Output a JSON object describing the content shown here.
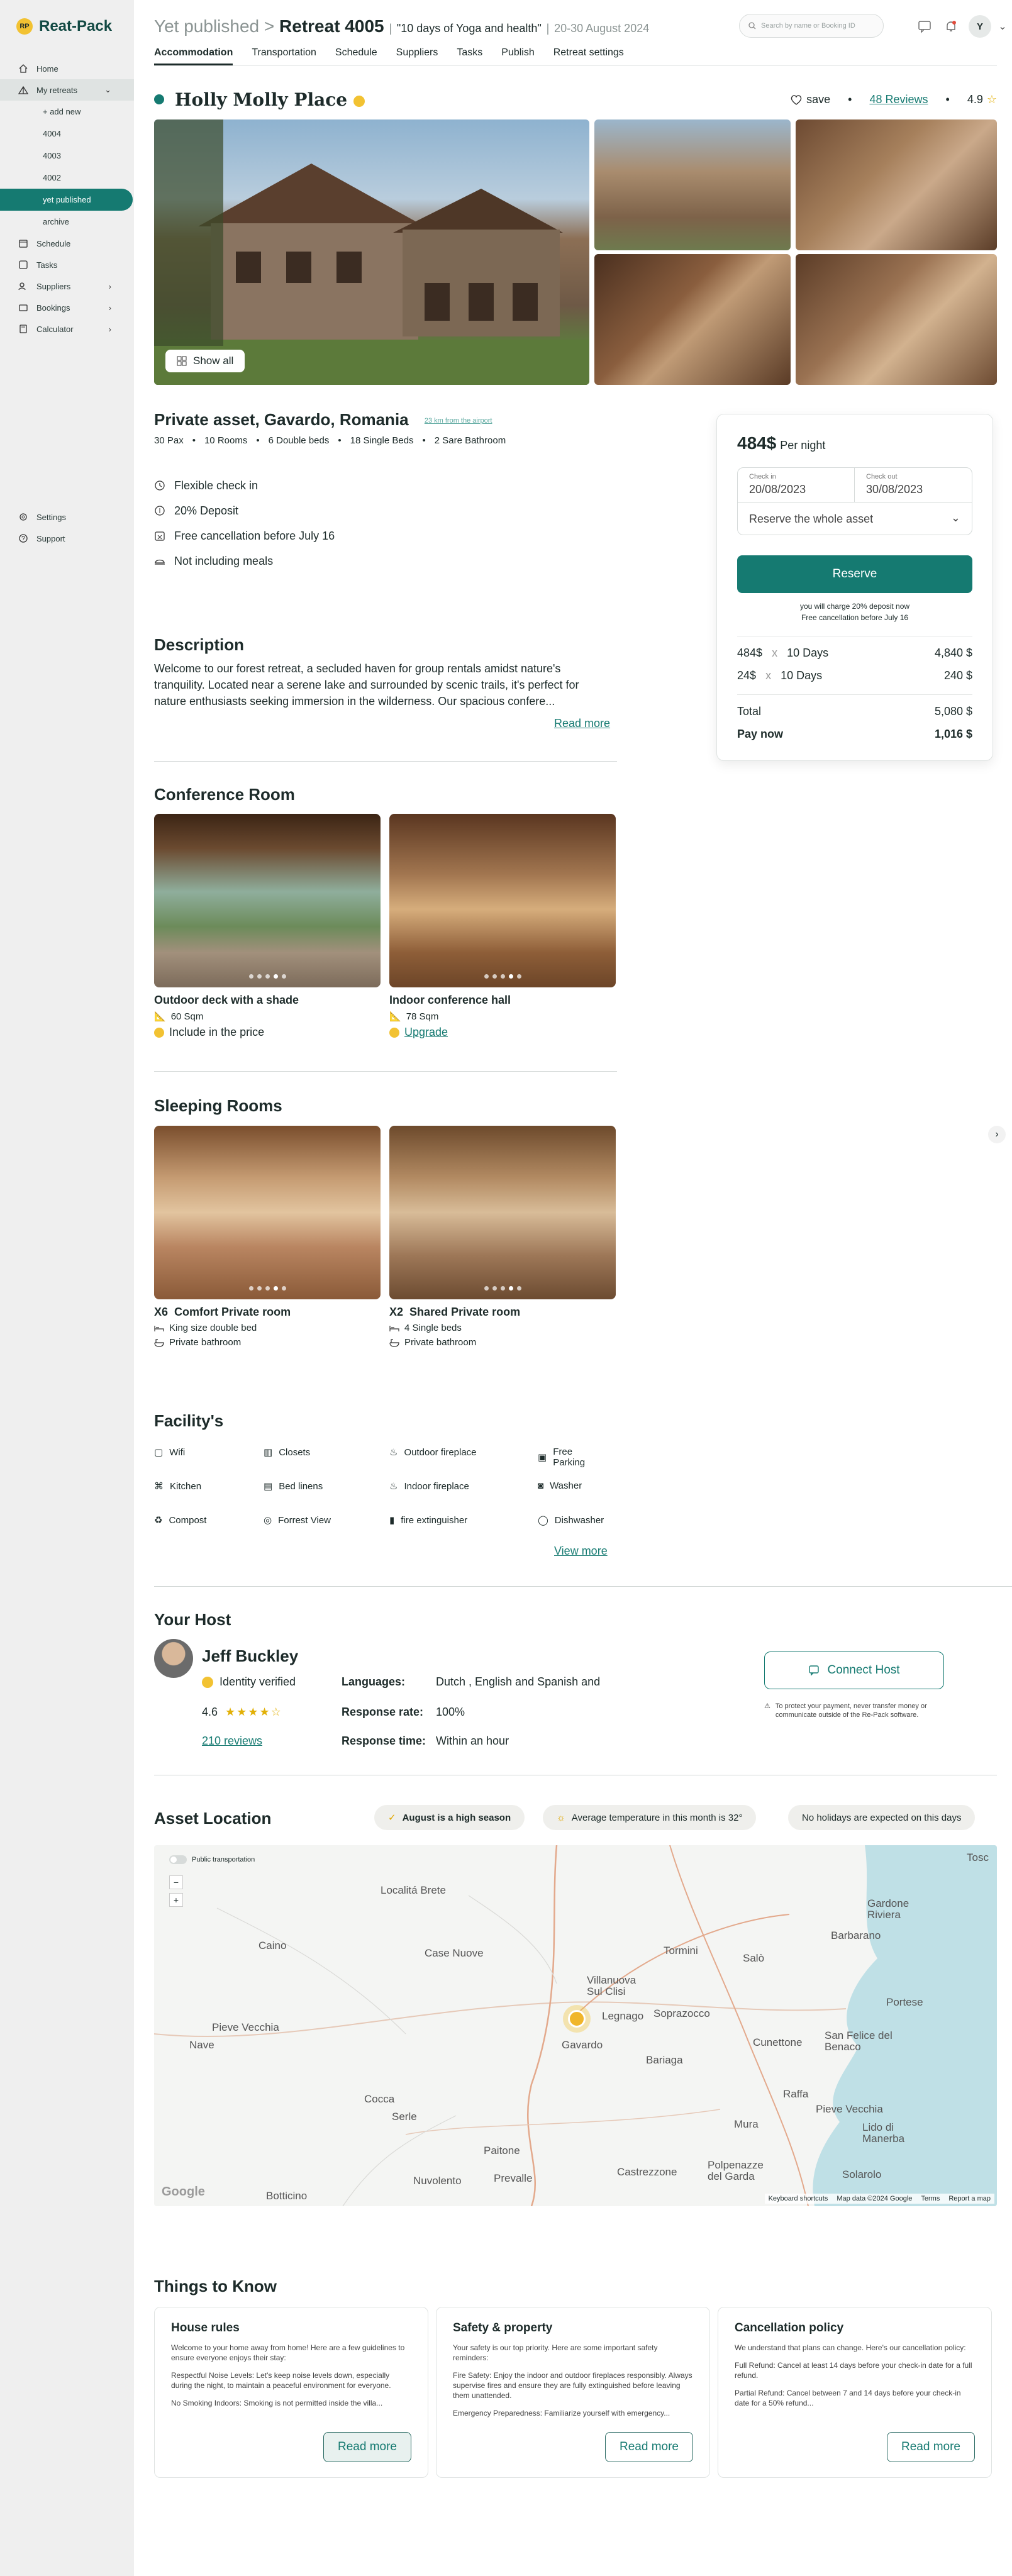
{
  "app": {
    "name": "Reat-Pack",
    "logo_text": "RP"
  },
  "sidebar": {
    "items": [
      {
        "label": "Home",
        "icon": "home-icon"
      },
      {
        "label": "My retreats",
        "icon": "tent-icon"
      },
      {
        "label": "Schedule",
        "icon": "calendar-icon"
      },
      {
        "label": "Tasks",
        "icon": "tasks-icon"
      },
      {
        "label": "Suppliers",
        "icon": "suppliers-icon"
      },
      {
        "label": "Bookings",
        "icon": "bookings-icon"
      },
      {
        "label": "Calculator",
        "icon": "calculator-icon"
      }
    ],
    "subitems": [
      "+ add new",
      "4004",
      "4003",
      "4002",
      "yet published",
      "archive"
    ],
    "bottom": [
      {
        "label": "Settings",
        "icon": "gear-icon"
      },
      {
        "label": "Support",
        "icon": "support-icon"
      }
    ]
  },
  "header": {
    "status": "Yet published",
    "retreat": "Retreat 4005",
    "retreat_name": "\"10 days of Yoga and health\"",
    "dates": "20-30 August 2024",
    "search_placeholder": "Search by name or Booking ID",
    "avatar": "Y"
  },
  "tabs": [
    "Accommodation",
    "Transportation",
    "Schedule",
    "Suppliers",
    "Tasks",
    "Publish",
    "Retreat settings"
  ],
  "listing": {
    "title": "Holly Molly Place",
    "save": "save",
    "reviews": "48 Reviews",
    "rating": "4.9",
    "show_all": "Show all",
    "asset_title": "Private asset, Gavardo, Romania",
    "distance": "23 km from the airport",
    "meta": [
      "30 Pax",
      "10 Rooms",
      "6 Double beds",
      "18 Single Beds",
      "2 Sare Bathroom"
    ],
    "perks": [
      {
        "label": "Flexible check in",
        "icon": "clock-icon"
      },
      {
        "label": "20% Deposit",
        "icon": "coin-icon"
      },
      {
        "label": "Free cancellation before July 16",
        "icon": "calendar-x-icon"
      },
      {
        "label": "Not including meals",
        "icon": "meal-icon"
      }
    ]
  },
  "description": {
    "heading": "Description",
    "text": "Welcome to our forest retreat, a secluded haven for group rentals amidst nature's tranquility. Located near a serene lake and surrounded by scenic trails, it's perfect for nature enthusiasts seeking immersion in the wilderness. Our spacious confere...",
    "read_more": "Read more"
  },
  "booking": {
    "price": "484$",
    "per_night": "Per night",
    "checkin_label": "Check in",
    "checkin": "20/08/2023",
    "checkout_label": "Check out",
    "checkout": "30/08/2023",
    "reserve_whole": "Reserve the whole asset",
    "reserve": "Reserve",
    "note1": "you will charge 20% deposit now",
    "note2": "Free cancellation before July 16",
    "lines": [
      {
        "a": "484$",
        "x": "x",
        "b": "10 Days",
        "total": "4,840 $"
      },
      {
        "a": "24$",
        "x": "x",
        "b": "10 Days",
        "total": "240 $"
      }
    ],
    "total_label": "Total",
    "total": "5,080 $",
    "paynow_label": "Pay now",
    "paynow": "1,016 $"
  },
  "conference": {
    "heading": "Conference Room",
    "rooms": [
      {
        "name": "Outdoor deck with a shade",
        "size": "60 Sqm",
        "extra": "Include in the price"
      },
      {
        "name": "Indoor conference hall",
        "size": "78 Sqm",
        "extra": "Upgrade"
      }
    ]
  },
  "sleeping": {
    "heading": "Sleeping Rooms",
    "rooms": [
      {
        "count": "X6",
        "name": "Comfort Private room",
        "beds": "King size double bed",
        "bath": "Private bathroom"
      },
      {
        "count": "X2",
        "name": "Shared Private room",
        "beds": "4 Single beds",
        "bath": "Private bathroom"
      }
    ]
  },
  "facilities": {
    "heading": "Facility's",
    "items": [
      [
        "Wifi",
        "Closets",
        "Outdoor fireplace",
        "Free Parking"
      ],
      [
        "Kitchen",
        "Bed linens",
        "Indoor fireplace",
        "Washer"
      ],
      [
        "Compost",
        "Forrest View",
        "fire extinguisher",
        "Dishwasher"
      ]
    ],
    "view_more": "View more"
  },
  "host": {
    "heading": "Your Host",
    "name": "Jeff Buckley",
    "verified": "Identity verified",
    "rating": "4.6",
    "reviews": "210 reviews",
    "languages_label": "Languages:",
    "languages": "Dutch , English and Spanish and",
    "response_rate_label": "Response rate:",
    "response_rate": "100%",
    "response_time_label": "Response time:",
    "response_time": "Within an hour",
    "connect": "Connect Host",
    "protect_note": "To protect your payment, never transfer money or communicate outside of the Re-Pack software."
  },
  "location": {
    "heading": "Asset Location",
    "pills": [
      "August is a high season",
      "Average temperature in this month is 32°",
      "No holidays are expected on this days"
    ],
    "transport_toggle": "Public transportation",
    "zoom_out": "−",
    "zoom_in": "+",
    "places": [
      "Localitá Brete",
      "Caino",
      "Case Nuove",
      "Tormini",
      "Salò",
      "Villanuova Sul Clisi",
      "Gardone Riviera",
      "Barbarano",
      "Tosc",
      "Pieve Vecchia",
      "Nave",
      "Legnago",
      "Soprazocco",
      "Gavardo",
      "Bariaga",
      "Portese",
      "Cunettone",
      "San Felice del Benaco",
      "Cocca",
      "Serle",
      "Raffa",
      "Pieve Vecchia",
      "Lido di Manerba",
      "Paitone",
      "Mura",
      "Nuvolento",
      "Prevalle",
      "Castrezzone",
      "Polpenazze del Garda",
      "Solarolo",
      "Botticino"
    ],
    "google": "Google",
    "footer": [
      "Keyboard shortcuts",
      "Map data ©2024 Google",
      "Terms",
      "Report a map"
    ]
  },
  "things": {
    "heading": "Things to Know",
    "cards": [
      {
        "title": "House rules",
        "p1": "Welcome to your home away from home! Here are a few guidelines to ensure everyone enjoys their stay:",
        "p2": "Respectful Noise Levels: Let's keep noise levels down, especially during the night, to maintain a peaceful environment for everyone.",
        "p3": "No Smoking Indoors: Smoking is not permitted inside the villa...",
        "btn": "Read more"
      },
      {
        "title": "Safety & property",
        "p1": "Your safety is our top priority. Here are some important safety reminders:",
        "p2": "Fire Safety: Enjoy the indoor and outdoor fireplaces responsibly. Always supervise fires and ensure they are fully extinguished before leaving them unattended.",
        "p3": "Emergency Preparedness: Familiarize yourself with emergency...",
        "btn": "Read more"
      },
      {
        "title": "Cancellation policy",
        "p1": "We understand that plans can change. Here's our cancellation policy:",
        "p2": "Full Refund: Cancel at least 14 days before your check-in date for a full refund.",
        "p3": "Partial Refund: Cancel between 7 and 14 days before your check-in date for a 50% refund...",
        "btn": "Read more"
      }
    ]
  },
  "colors": {
    "accent": "#157a71",
    "sidebar": "#efefef",
    "star": "#e2b007"
  }
}
